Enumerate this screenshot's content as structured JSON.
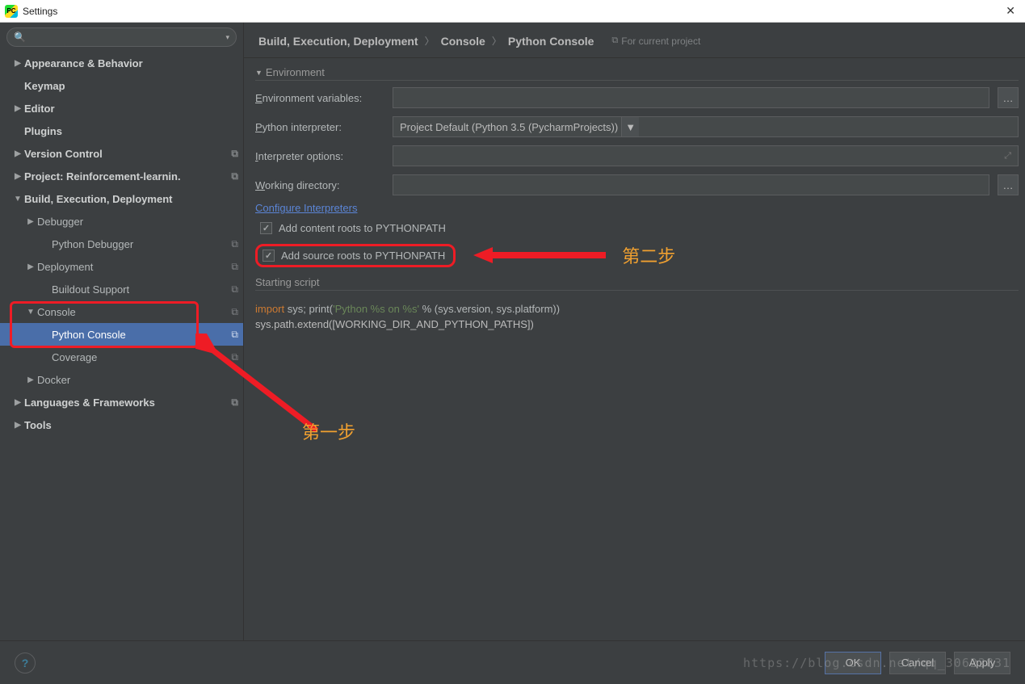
{
  "window": {
    "title": "Settings"
  },
  "sidebar": {
    "items": [
      {
        "label": "Appearance & Behavior"
      },
      {
        "label": "Keymap"
      },
      {
        "label": "Editor"
      },
      {
        "label": "Plugins"
      },
      {
        "label": "Version Control"
      },
      {
        "label": "Project: Reinforcement-learnin."
      },
      {
        "label": "Build, Execution, Deployment"
      },
      {
        "label": "Debugger"
      },
      {
        "label": "Python Debugger"
      },
      {
        "label": "Deployment"
      },
      {
        "label": "Buildout Support"
      },
      {
        "label": "Console"
      },
      {
        "label": "Python Console"
      },
      {
        "label": "Coverage"
      },
      {
        "label": "Docker"
      },
      {
        "label": "Languages & Frameworks"
      },
      {
        "label": "Tools"
      }
    ]
  },
  "breadcrumb": {
    "a": "Build, Execution, Deployment",
    "b": "Console",
    "c": "Python Console",
    "scope": "For current project"
  },
  "env": {
    "section": "Environment",
    "env_vars_label": "Environment variables:",
    "env_vars_value": "",
    "interp_label": "Python interpreter:",
    "interp_value": "Project Default (Python 3.5 (PycharmProjects))",
    "opts_label": "Interpreter options:",
    "opts_value": "",
    "wd_label": "Working directory:",
    "wd_value": "",
    "configure_link": "Configure Interpreters",
    "cb1": "Add content roots to PYTHONPATH",
    "cb2": "Add source roots to PYTHONPATH",
    "script_section": "Starting script"
  },
  "code": {
    "l1a": "import ",
    "l1b": "sys; ",
    "l1c": "print",
    "l1d": "(",
    "l1e": "'Python %s on %s'",
    "l1f": " % (sys.version",
    "l1g": ", ",
    "l1h": "sys.platform))",
    "l2": "sys.path.extend([WORKING_DIR_AND_PYTHON_PATHS])"
  },
  "annot": {
    "step1": "第一步",
    "step2": "第二步"
  },
  "buttons": {
    "ok": "OK",
    "cancel": "Cancel",
    "apply": "Apply"
  },
  "watermark": "https://blog.csdn.net/qq_30622831"
}
